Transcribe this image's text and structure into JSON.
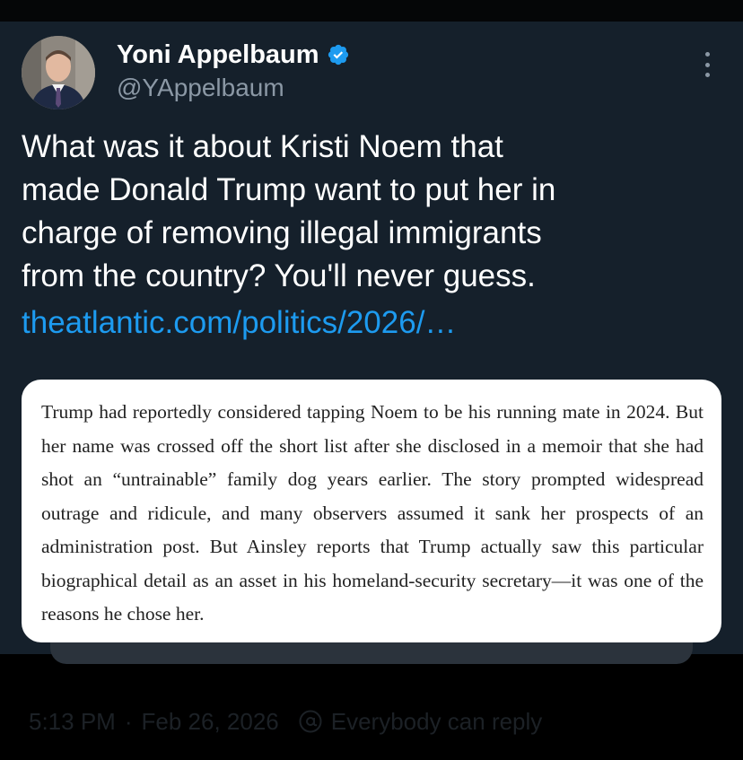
{
  "tweet": {
    "author": {
      "display_name": "Yoni Appelbaum",
      "handle": "@YAppelbaum",
      "verified": true,
      "avatar_icon": "profile-photo"
    },
    "text": "What was it about Kristi Noem that\nmade Donald Trump want to put her in\ncharge of removing illegal immigrants\nfrom the country? You'll never guess.",
    "link": "theatlantic.com/politics/2026/…",
    "quote_image_text": "Trump had reportedly considered tapping Noem to be his running mate in 2024. But her name was crossed off the short list after she disclosed in a memoir that she had shot an “untrainable” family dog years earlier. The story prompted widespread outrage and ridicule, and many observers assumed it sank her prospects of an administration post. But Ainsley reports that Trump actually saw this particular biographical detail as an asset in his homeland-security secretary—it was one of the reasons he chose her.",
    "time": "5:13 PM",
    "separator": "·",
    "date": "Feb 26, 2026",
    "reply_setting": "Everybody can reply"
  },
  "colors": {
    "background": "#15202b",
    "accent": "#1d9bf0",
    "text_primary": "#ffffff",
    "text_secondary": "#8b98a5"
  }
}
